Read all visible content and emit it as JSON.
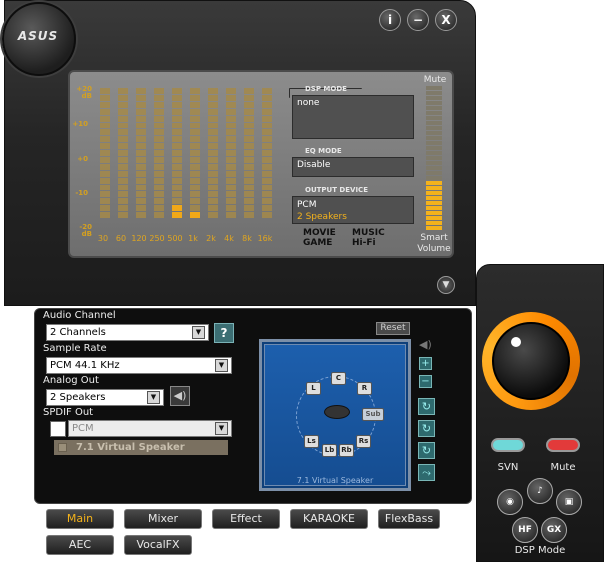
{
  "brand": {
    "logo": "ASUS"
  },
  "window_buttons": {
    "info": "i",
    "minimize": "−",
    "close": "X"
  },
  "eq": {
    "db_labels": [
      "+20\ndB",
      "+10",
      "+0",
      "-10",
      "-20\ndB"
    ],
    "bands": [
      "30",
      "60",
      "120",
      "250",
      "500",
      "1k",
      "2k",
      "4k",
      "8k",
      "16k"
    ],
    "levels": [
      0,
      0,
      0,
      0,
      2,
      1,
      0,
      0,
      0,
      0
    ]
  },
  "dsp_mode": {
    "title": "DSP MODE",
    "value": "none"
  },
  "eq_mode": {
    "title": "EQ MODE",
    "value": "Disable"
  },
  "output_device": {
    "title": "OUTPUT DEVICE",
    "line1": "PCM",
    "line2": "2 Speakers"
  },
  "badges": {
    "movie": "MOVIE",
    "game": "GAME",
    "music": "MUSIC",
    "hifi": "Hi-Fi"
  },
  "volume": {
    "mute_label": "Mute",
    "smart_label_1": "Smart",
    "smart_label_2": "Volume",
    "level": 0.35
  },
  "audio_channel": {
    "label": "Audio Channel",
    "value": "2 Channels",
    "help": "?"
  },
  "sample_rate": {
    "label": "Sample Rate",
    "value": "PCM 44.1 KHz"
  },
  "analog_out": {
    "label": "Analog Out",
    "value": "2 Speakers"
  },
  "spdif_out": {
    "label": "SPDIF Out",
    "value": "PCM"
  },
  "virtual_speaker": {
    "label": "7.1 Virtual Speaker",
    "caption": "7.1 Virtual Speaker"
  },
  "speakers": {
    "reset": "Reset",
    "L": "L",
    "C": "C",
    "R": "R",
    "Sub": "Sub",
    "Ls": "Ls",
    "Rs": "Rs",
    "Lb": "Lb",
    "Rb": "Rb"
  },
  "tabs": [
    "Main",
    "Mixer",
    "Effect",
    "KARAOKE",
    "FlexBass",
    "AEC",
    "VocalFX"
  ],
  "right": {
    "svn": "SVN",
    "mute": "Mute",
    "dsp_mode": "DSP Mode",
    "hf": "HF",
    "gx": "GX"
  },
  "colors": {
    "accent": "#f3b21c",
    "svn": "#6fd8d8",
    "mute": "#e23a3a"
  }
}
